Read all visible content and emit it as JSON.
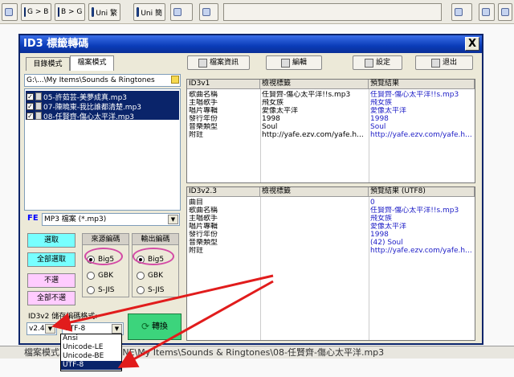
{
  "toolbar": {
    "buttons": [
      "G > B",
      "B > G",
      "Uni 繁",
      "Uni 簡"
    ]
  },
  "statusbar": {
    "text": "檔案模式下...E\\SMARTONE\\My Items\\Sounds & Ringtones\\08-任賢齊-傷心太平洋.mp3"
  },
  "dialog": {
    "title": "ID3 標籤轉碼",
    "close": "X",
    "tabs": [
      "目錄模式",
      "檔案模式"
    ],
    "path": "G:\\...\\My Items\\Sounds & Ringtones",
    "files": [
      "05-許茹芸-美夢成真.mp3",
      "07-陳曉東-我比誰都清楚.mp3",
      "08-任賢齊-傷心太平洋.mp3"
    ],
    "filter_label": "FE",
    "filter_value": "MP3 檔案 (*.mp3)",
    "buttons": {
      "select": "選取",
      "select_all": "全部選取",
      "deselect": "不選",
      "deselect_all": "全部不選"
    },
    "source_group": {
      "title": "來源編碼",
      "options": [
        "Big5",
        "GBK",
        "S-JIS"
      ]
    },
    "output_group": {
      "title": "輸出編碼",
      "options": [
        "Big5",
        "GBK",
        "S-JIS"
      ]
    },
    "id3v2_label": "ID3v2 儲存編碼格式:",
    "version_value": "v2.4",
    "encoding_value": "UTF-8",
    "encoding_options": [
      "Ansi",
      "Unicode-LE",
      "Unicode-BE",
      "UTF-8"
    ],
    "convert": "轉換",
    "right_buttons": [
      "檔案資訊",
      "編輯",
      "設定",
      "退出"
    ],
    "table1": {
      "headers": [
        "ID3v1",
        "檢視標籤",
        "預覽結果"
      ],
      "rows": [
        [
          "歌曲名稱",
          "任賢齊-傷心太平洋!!s.mp3",
          "任賢齊-傷心太平洋!!s.mp3"
        ],
        [
          "主唱歌手",
          "飛女族",
          "飛女族"
        ],
        [
          "唱片專輯",
          "愛像太平洋",
          "愛像太平洋"
        ],
        [
          "發行年份",
          "1998",
          "1998"
        ],
        [
          "音樂類型",
          "Soul",
          "Soul"
        ],
        [
          "附註",
          "http://yafe.ezv.com/yafe.h...",
          "http://yafe.ezv.com/yafe.h..."
        ]
      ]
    },
    "table2": {
      "headers": [
        "ID3v2.3",
        "檢視標籤",
        "預覽結果 (UTF8)"
      ],
      "rows": [
        [
          "曲目",
          "",
          "0"
        ],
        [
          "歌曲名稱",
          "",
          "任賢齊-傷心太平洋!!s.mp3"
        ],
        [
          "主唱歌手",
          "",
          "飛女族"
        ],
        [
          "唱片專輯",
          "",
          "愛像太平洋"
        ],
        [
          "發行年份",
          "",
          "1998"
        ],
        [
          "音樂類型",
          "",
          "(42) Soul"
        ],
        [
          "附註",
          "",
          "http://yafe.ezv.com/yafe.h..."
        ]
      ]
    }
  },
  "colors": {
    "title_bar": "#0a3cb8",
    "selection": "#0a246a",
    "highlight_circle": "#d34aa5",
    "annotation_arrow": "#e11c1c",
    "cyan_button": "#77ffff",
    "pink_button": "#ffccff",
    "convert_button": "#3cd47c"
  }
}
